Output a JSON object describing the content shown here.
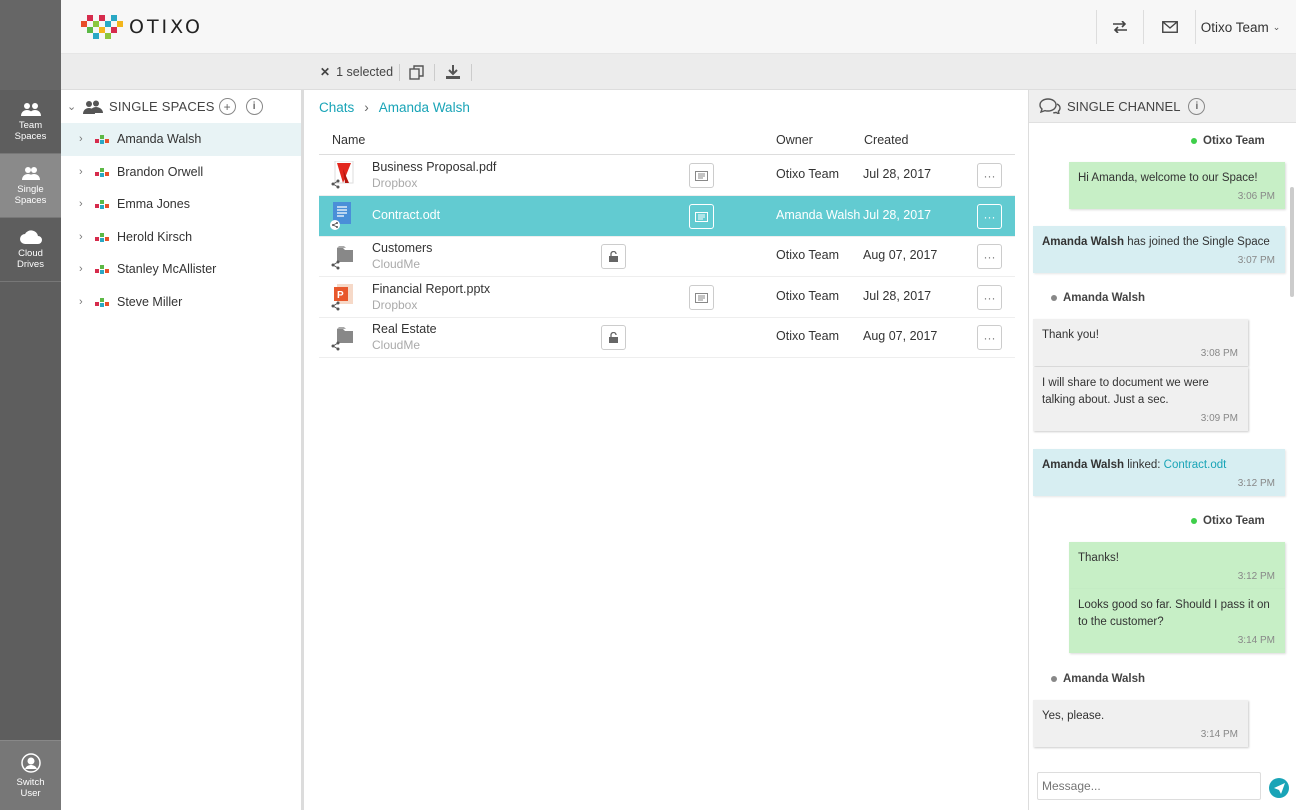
{
  "app": {
    "logo_text": "OTIXO"
  },
  "header": {
    "user_label": "Otixo Team"
  },
  "rail": {
    "items": [
      {
        "label_line1": "Team",
        "label_line2": "Spaces"
      },
      {
        "label_line1": "Single",
        "label_line2": "Spaces"
      },
      {
        "label_line1": "Cloud",
        "label_line2": "Drives"
      }
    ],
    "switch_line1": "Switch",
    "switch_line2": "User"
  },
  "toolbar": {
    "selected_label": "1 selected"
  },
  "tree": {
    "title": "SINGLE SPACES",
    "items": [
      {
        "label": "Amanda Walsh"
      },
      {
        "label": "Brandon Orwell"
      },
      {
        "label": "Emma Jones"
      },
      {
        "label": "Herold Kirsch"
      },
      {
        "label": "Stanley McAllister"
      },
      {
        "label": "Steve Miller"
      }
    ]
  },
  "breadcrumb": {
    "root": "Chats",
    "current": "Amanda Walsh"
  },
  "table": {
    "columns": {
      "name": "Name",
      "owner": "Owner",
      "created": "Created"
    },
    "rows": [
      {
        "name": "Business Proposal.pdf",
        "source": "Dropbox",
        "owner": "Otixo Team",
        "created": "Jul 28, 2017"
      },
      {
        "name": "Contract.odt",
        "source": "",
        "owner": "Amanda Walsh",
        "created": "Jul 28, 2017"
      },
      {
        "name": "Customers",
        "source": "CloudMe",
        "owner": "Otixo Team",
        "created": "Aug 07, 2017"
      },
      {
        "name": "Financial Report.pptx",
        "source": "Dropbox",
        "owner": "Otixo Team",
        "created": "Jul 28, 2017"
      },
      {
        "name": "Real Estate",
        "source": "CloudMe",
        "owner": "Otixo Team",
        "created": "Aug 07, 2017"
      }
    ]
  },
  "chat": {
    "title": "SINGLE CHANNEL",
    "messages": [
      {
        "sender": "Otixo Team",
        "text": "Hi Amanda, welcome to our Space!",
        "time": "3:06 PM"
      },
      {
        "sys_name": "Amanda Walsh",
        "sys_text": " has joined the Single Space",
        "time": "3:07 PM"
      },
      {
        "sender": "Amanda Walsh",
        "text": "Thank you!",
        "time": "3:08 PM"
      },
      {
        "text": "I will share to document we were talking about. Just a sec.",
        "time": "3:09 PM"
      },
      {
        "sys_name": "Amanda Walsh",
        "sys_text": " linked: ",
        "link": "Contract.odt",
        "time": "3:12 PM"
      },
      {
        "sender": "Otixo Team",
        "text": "Thanks!",
        "time": "3:12 PM"
      },
      {
        "text": "Looks good so far. Should I pass it on to the customer?",
        "time": "3:14 PM"
      },
      {
        "sender": "Amanda Walsh",
        "text": "Yes, please.",
        "time": "3:14 PM"
      }
    ],
    "input_placeholder": "Message..."
  },
  "colors": {
    "accent": "#19a4b7",
    "selected_row": "#62cbd1",
    "bubble_self": "#c7efc6",
    "bubble_other": "#f0f0f0",
    "bubble_system": "#d7eef2"
  }
}
